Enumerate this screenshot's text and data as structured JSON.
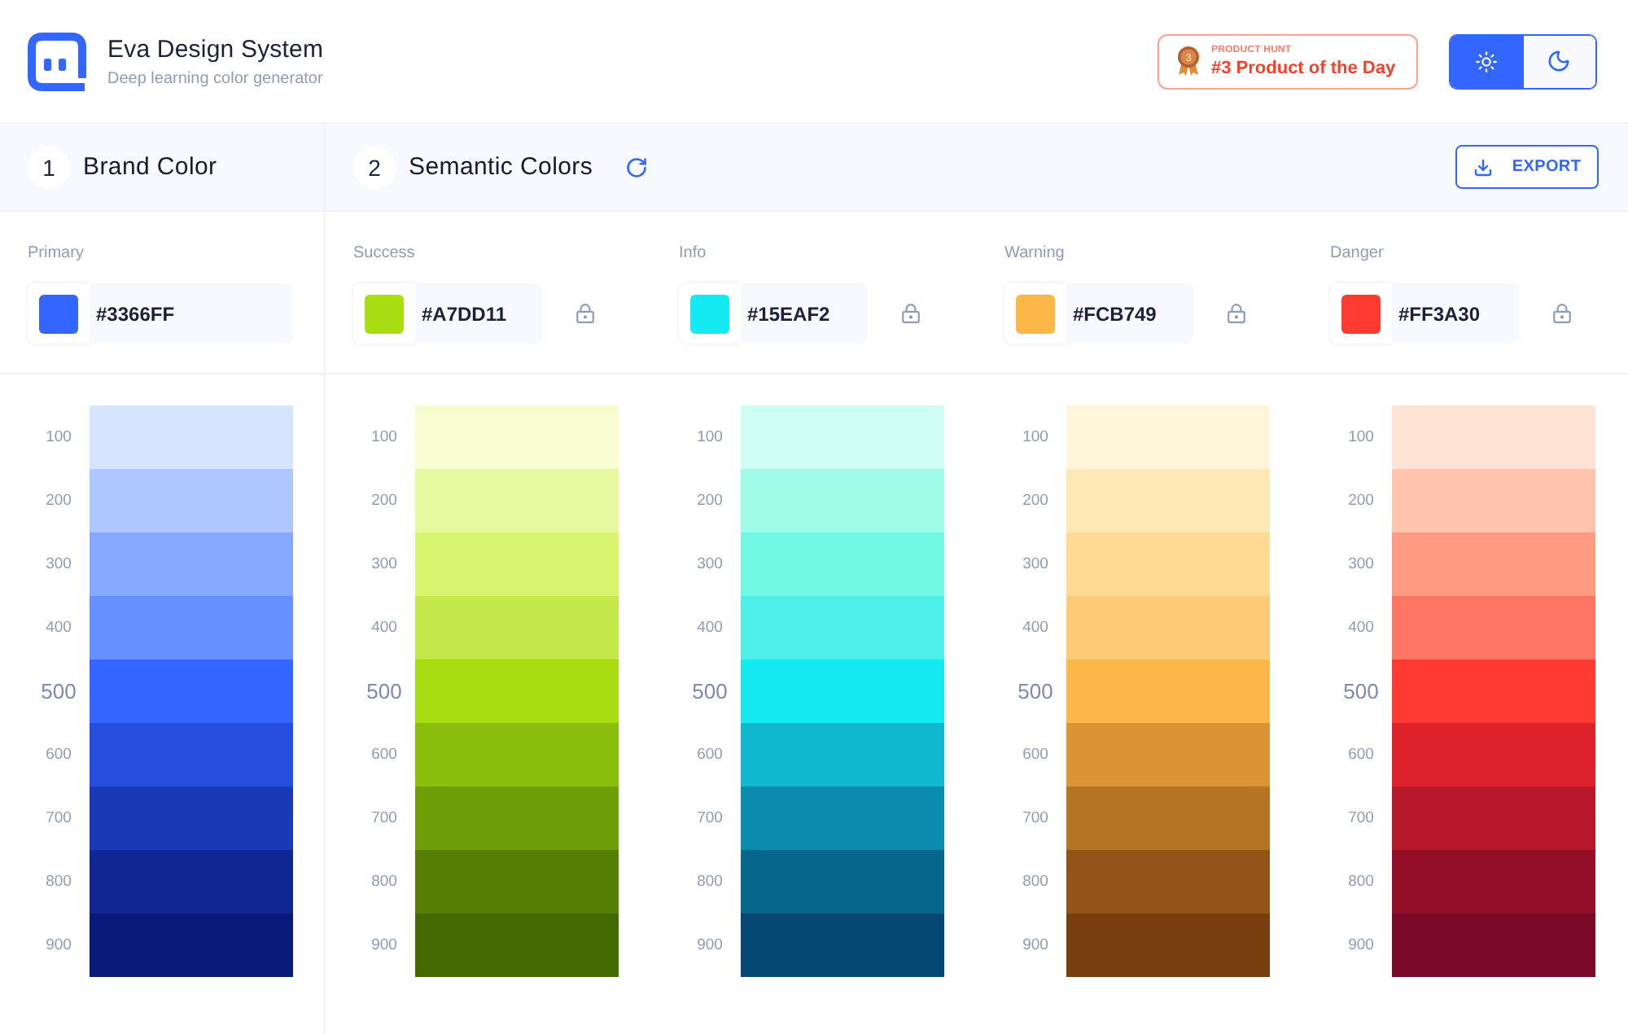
{
  "header": {
    "title": "Eva Design System",
    "subtitle": "Deep learning color generator",
    "badge": {
      "medal_rank": "3",
      "label": "PRODUCT HUNT",
      "text": "#3 Product of the Day"
    },
    "theme_toggle": [
      {
        "kind": "light",
        "selected": true
      },
      {
        "kind": "dark",
        "selected": false
      }
    ]
  },
  "sections": [
    {
      "kind": "brand",
      "number": "1",
      "title": "Brand Color",
      "colors": [
        {
          "label": "Primary",
          "value": "#3366FF",
          "color": "#3366ff",
          "shades": [
            {
              "label": "100",
              "color": "#d6e4ff",
              "base": false
            },
            {
              "label": "200",
              "color": "#adc8ff",
              "base": false
            },
            {
              "label": "300",
              "color": "#84a9ff",
              "base": false
            },
            {
              "label": "400",
              "color": "#6690ff",
              "base": false
            },
            {
              "label": "500",
              "color": "#3366ff",
              "base": true
            },
            {
              "label": "600",
              "color": "#254edb",
              "base": false
            },
            {
              "label": "700",
              "color": "#1939b7",
              "base": false
            },
            {
              "label": "800",
              "color": "#102693",
              "base": false
            },
            {
              "label": "900",
              "color": "#091a7a",
              "base": false
            }
          ]
        }
      ]
    },
    {
      "kind": "semantic",
      "number": "2",
      "title": "Semantic Colors",
      "export_button": "EXPORT",
      "colors": [
        {
          "label": "Success",
          "value": "#A7DD11",
          "color": "#a7dd11",
          "shades": [
            {
              "label": "100",
              "color": "#f6fcd0",
              "base": false
            },
            {
              "label": "200",
              "color": "#e8fa9e",
              "base": false
            },
            {
              "label": "300",
              "color": "#d7f46e",
              "base": false
            },
            {
              "label": "400",
              "color": "#c4e849",
              "base": false
            },
            {
              "label": "500",
              "color": "#a7dd11",
              "base": true
            },
            {
              "label": "600",
              "color": "#89be0c",
              "base": false
            },
            {
              "label": "700",
              "color": "#6e9f08",
              "base": false
            },
            {
              "label": "800",
              "color": "#558005",
              "base": false
            },
            {
              "label": "900",
              "color": "#436a03",
              "base": false
            }
          ]
        },
        {
          "label": "Info",
          "value": "#15EAF2",
          "color": "#15eaf2",
          "shades": [
            {
              "label": "100",
              "color": "#cefdf1",
              "base": false
            },
            {
              "label": "200",
              "color": "#a0fce8",
              "base": false
            },
            {
              "label": "300",
              "color": "#70f8e4",
              "base": false
            },
            {
              "label": "400",
              "color": "#4df0e8",
              "base": false
            },
            {
              "label": "500",
              "color": "#15eaf2",
              "base": true
            },
            {
              "label": "600",
              "color": "#0fb8d0",
              "base": false
            },
            {
              "label": "700",
              "color": "#0a8dae",
              "base": false
            },
            {
              "label": "800",
              "color": "#06668c",
              "base": false
            },
            {
              "label": "900",
              "color": "#044974",
              "base": false
            }
          ]
        },
        {
          "label": "Warning",
          "value": "#FCB749",
          "color": "#fcb749",
          "shades": [
            {
              "label": "100",
              "color": "#fef5db",
              "base": false
            },
            {
              "label": "200",
              "color": "#fee9b6",
              "base": false
            },
            {
              "label": "300",
              "color": "#fed992",
              "base": false
            },
            {
              "label": "400",
              "color": "#fdca77",
              "base": false
            },
            {
              "label": "500",
              "color": "#fcb749",
              "base": true
            },
            {
              "label": "600",
              "color": "#d89435",
              "base": false
            },
            {
              "label": "700",
              "color": "#b57324",
              "base": false
            },
            {
              "label": "800",
              "color": "#925517",
              "base": false
            },
            {
              "label": "900",
              "color": "#783f0e",
              "base": false
            }
          ]
        },
        {
          "label": "Danger",
          "value": "#FF3A30",
          "color": "#ff3a30",
          "shades": [
            {
              "label": "100",
              "color": "#ffe3d5",
              "base": false
            },
            {
              "label": "200",
              "color": "#ffc2ac",
              "base": false
            },
            {
              "label": "300",
              "color": "#ff9b82",
              "base": false
            },
            {
              "label": "400",
              "color": "#ff7663",
              "base": false
            },
            {
              "label": "500",
              "color": "#ff3a30",
              "base": true
            },
            {
              "label": "600",
              "color": "#db2329",
              "base": false
            },
            {
              "label": "700",
              "color": "#b7182a",
              "base": false
            },
            {
              "label": "800",
              "color": "#930e29",
              "base": false
            },
            {
              "label": "900",
              "color": "#7a0928",
              "base": false
            }
          ]
        }
      ]
    }
  ]
}
